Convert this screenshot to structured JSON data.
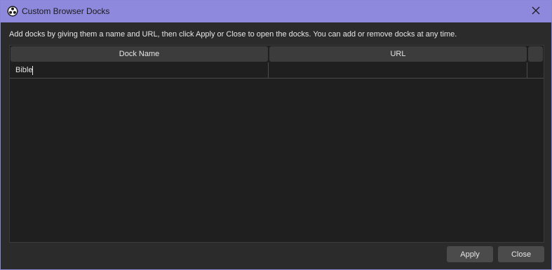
{
  "window": {
    "title": "Custom Browser Docks",
    "app_icon": "obs-logo-icon",
    "close_icon": "close-icon"
  },
  "instructions": "Add docks by giving them a name and URL, then click Apply or Close to open the docks. You can add or remove docks at any time.",
  "table": {
    "columns": [
      "Dock Name",
      "URL",
      ""
    ],
    "rows": [
      {
        "dock_name": "Bible",
        "url": ""
      }
    ]
  },
  "buttons": {
    "apply": "Apply",
    "close": "Close"
  },
  "colors": {
    "titlebar": "#8e89dc",
    "background": "#2b2b2b",
    "table_background": "#1f1f1f",
    "header_background": "#3c3c3c",
    "button_background": "#4b4b4b",
    "text": "#e6e6e6"
  }
}
